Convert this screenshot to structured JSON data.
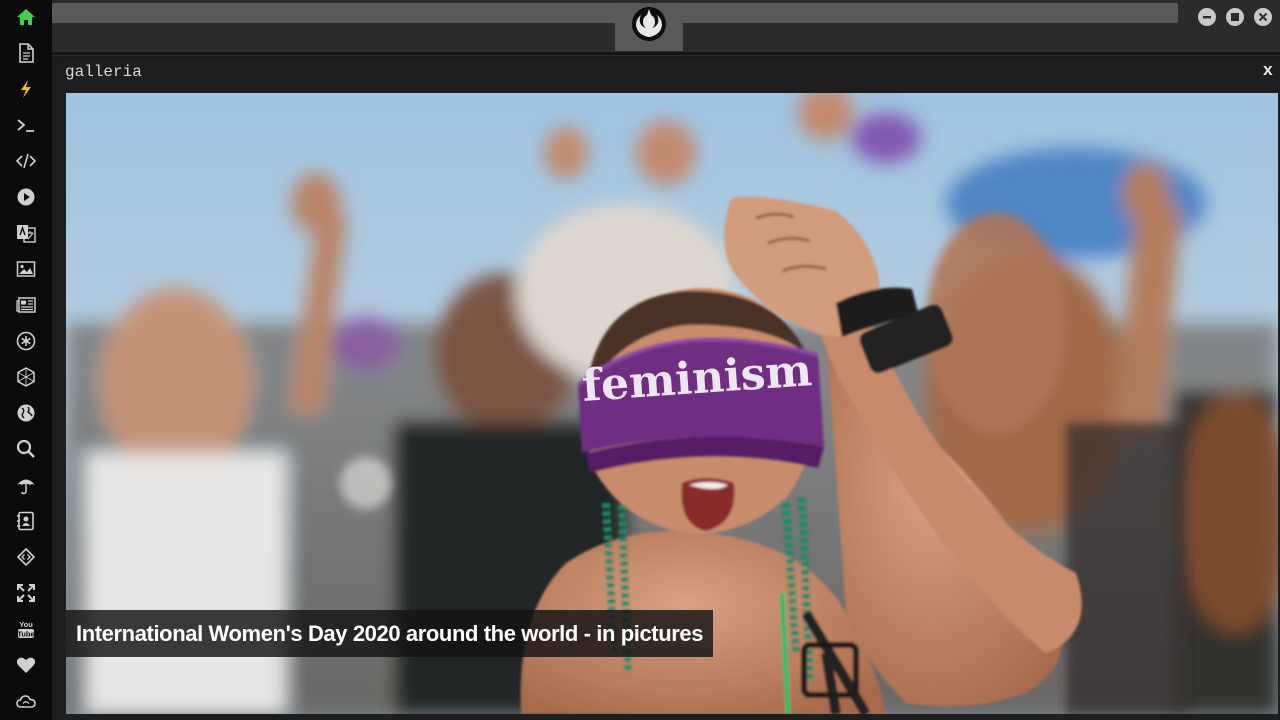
{
  "sidebar": {
    "items": [
      {
        "icon": "home-icon",
        "color": "#3ecf4f"
      },
      {
        "icon": "document-icon"
      },
      {
        "icon": "lightning-icon",
        "color": "#f1c40f"
      },
      {
        "icon": "terminal-icon"
      },
      {
        "icon": "code-icon"
      },
      {
        "icon": "play-circle-icon"
      },
      {
        "icon": "translate-icon"
      },
      {
        "icon": "image-icon"
      },
      {
        "icon": "newspaper-icon"
      },
      {
        "icon": "asterisk-circle-icon"
      },
      {
        "icon": "hexagon-icon"
      },
      {
        "icon": "globe-icon"
      },
      {
        "icon": "search-icon"
      },
      {
        "icon": "umbrella-icon"
      },
      {
        "icon": "address-book-icon"
      },
      {
        "icon": "code-diamond-icon"
      },
      {
        "icon": "expand-icon"
      },
      {
        "icon": "youtube-icon"
      },
      {
        "icon": "heart-icon"
      },
      {
        "icon": "cloud-icon"
      }
    ]
  },
  "topbar": {
    "logo_icon": "rebel-alliance-icon",
    "window_controls": [
      "minimize-icon",
      "maximize-icon",
      "close-icon"
    ]
  },
  "panel": {
    "title": "galleria",
    "close_label": "x"
  },
  "gallery": {
    "caption": "International Women's Day 2020 around the world - in pictures",
    "headband_text": "feminism"
  }
}
